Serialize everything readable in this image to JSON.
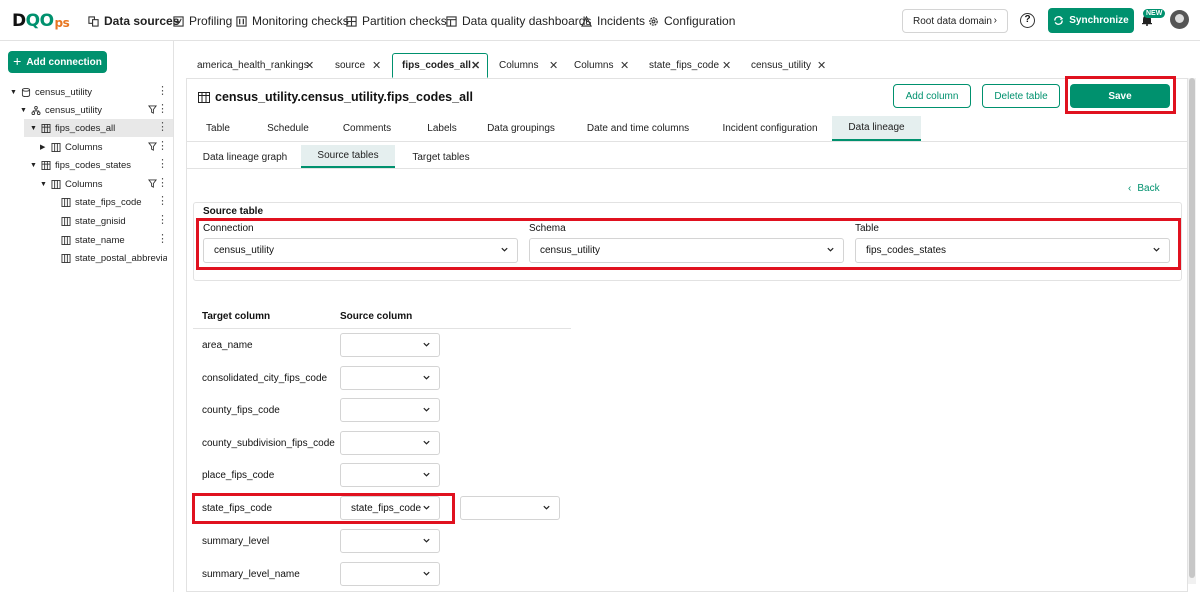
{
  "nav": {
    "logo_a": "D",
    "logo_oo": "QO",
    "logo_ps": "ps",
    "items": [
      {
        "label": "Data sources",
        "icon": "data-sources-icon",
        "active": true
      },
      {
        "label": "Profiling",
        "icon": "profiling-icon"
      },
      {
        "label": "Monitoring checks",
        "icon": "monitoring-icon"
      },
      {
        "label": "Partition checks",
        "icon": "partition-icon"
      },
      {
        "label": "Data quality dashboards",
        "icon": "dashboard-icon"
      },
      {
        "label": "Incidents",
        "icon": "warning-icon"
      },
      {
        "label": "Configuration",
        "icon": "gear-icon"
      }
    ],
    "root_domain": "Root data domain",
    "sync": "Synchronize",
    "new_badge": "NEW"
  },
  "sidebar": {
    "add_connection": "Add connection",
    "tree": [
      {
        "label": "census_utility"
      },
      {
        "label": "census_utility"
      },
      {
        "label": "fips_codes_all"
      },
      {
        "label": "Columns"
      },
      {
        "label": "fips_codes_states"
      },
      {
        "label": "Columns"
      },
      {
        "label": "state_fips_code"
      },
      {
        "label": "state_gnisid"
      },
      {
        "label": "state_name"
      },
      {
        "label": "state_postal_abbreviati"
      }
    ]
  },
  "page_tabs": [
    "america_health_rankings",
    "source",
    "fips_codes_all",
    "Columns",
    "Columns",
    "state_fips_code",
    "census_utility"
  ],
  "header": {
    "title": "census_utility.census_utility.fips_codes_all",
    "add_column": "Add column",
    "delete_table": "Delete table",
    "save": "Save"
  },
  "subtabs": [
    "Table",
    "Schedule",
    "Comments",
    "Labels",
    "Data groupings",
    "Date and time columns",
    "Incident configuration",
    "Data lineage"
  ],
  "subtabs2": [
    "Data lineage graph",
    "Source tables",
    "Target tables"
  ],
  "back": "Back",
  "source_table": {
    "heading": "Source table",
    "connection_label": "Connection",
    "connection_value": "census_utility",
    "schema_label": "Schema",
    "schema_value": "census_utility",
    "table_label": "Table",
    "table_value": "fips_codes_states"
  },
  "mapping": {
    "target_header": "Target column",
    "source_header": "Source column",
    "rows": [
      {
        "target": "area_name",
        "source": ""
      },
      {
        "target": "consolidated_city_fips_code",
        "source": ""
      },
      {
        "target": "county_fips_code",
        "source": ""
      },
      {
        "target": "county_subdivision_fips_code",
        "source": ""
      },
      {
        "target": "place_fips_code",
        "source": ""
      },
      {
        "target": "state_fips_code",
        "source": "state_fips_code"
      },
      {
        "target": "summary_level",
        "source": ""
      },
      {
        "target": "summary_level_name",
        "source": ""
      }
    ]
  },
  "colors": {
    "accent": "#00916e",
    "highlight": "#e0111f",
    "logo_ps": "#e87722"
  }
}
